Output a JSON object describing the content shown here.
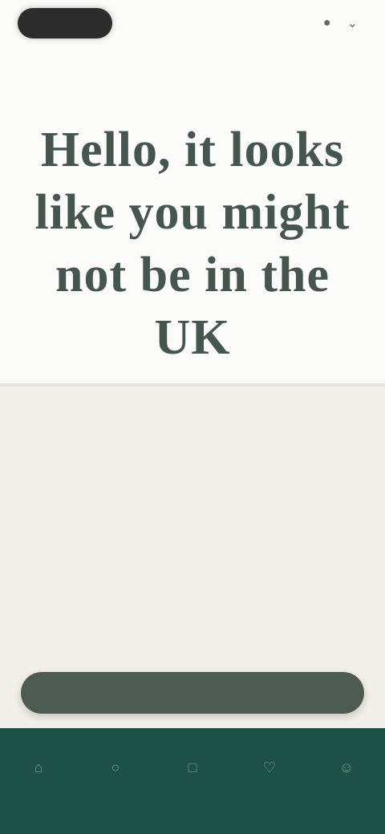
{
  "header": {
    "brand_icon": "logo-pill",
    "region_text": "",
    "region_icon": "globe-icon"
  },
  "hero": {
    "headline": "Hello, it looks like you might not be in the UK"
  },
  "card": {
    "body_text": "",
    "body_link": "",
    "secondary_link": "",
    "primary_button": ""
  },
  "bottom_nav": {
    "items": [
      {
        "icon": "home-icon",
        "label": ""
      },
      {
        "icon": "search-icon",
        "label": ""
      },
      {
        "icon": "bag-icon",
        "label": ""
      },
      {
        "icon": "heart-icon",
        "label": ""
      },
      {
        "icon": "user-icon",
        "label": ""
      }
    ]
  },
  "colors": {
    "page_bg": "#fbfbfa",
    "headline": "#45564f",
    "card_bg": "#f2efeb",
    "button_bg": "#4e5b53",
    "bottom_band": "#1e5145"
  }
}
